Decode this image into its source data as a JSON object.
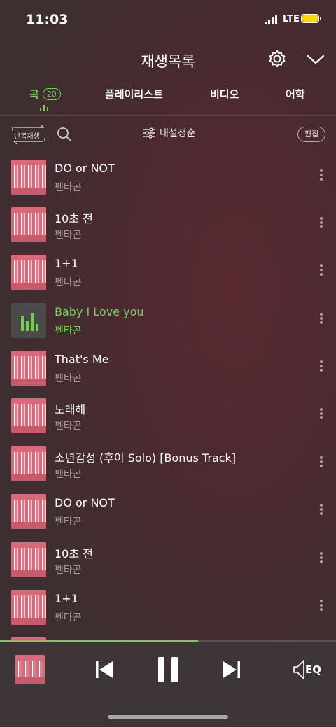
{
  "status": {
    "time": "11:03",
    "network": "LTE",
    "battery_color": "#ffd60a"
  },
  "header": {
    "title": "재생목록",
    "settings_icon": "gear-icon",
    "collapse_icon": "chevron-down-icon"
  },
  "tabs": [
    {
      "label": "곡",
      "count": "20",
      "active": true
    },
    {
      "label": "플레이리스트"
    },
    {
      "label": "비디오"
    },
    {
      "label": "어학"
    }
  ],
  "toolbar": {
    "repeat_label": "반복재생",
    "sort_label": "내설정순",
    "edit_label": "편집"
  },
  "songs": [
    {
      "title": "DO or NOT",
      "artist": "펜타곤"
    },
    {
      "title": "10초 전",
      "artist": "펜타곤"
    },
    {
      "title": "1+1",
      "artist": "펜타곤"
    },
    {
      "title": "Baby I Love you",
      "artist": "펜타곤",
      "active": true
    },
    {
      "title": "That's Me",
      "artist": "펜타곤"
    },
    {
      "title": "노래해",
      "artist": "펜타곤"
    },
    {
      "title": "소년감성 (후이 Solo) [Bonus Track]",
      "artist": "펜타곤"
    },
    {
      "title": "DO or NOT",
      "artist": "펜타곤"
    },
    {
      "title": "10초 전",
      "artist": "펜타곤"
    },
    {
      "title": "1+1",
      "artist": "펜타곤"
    }
  ],
  "player": {
    "progress": 0.59,
    "eq_label": "EQ",
    "accent_color": "#6fd14e"
  }
}
